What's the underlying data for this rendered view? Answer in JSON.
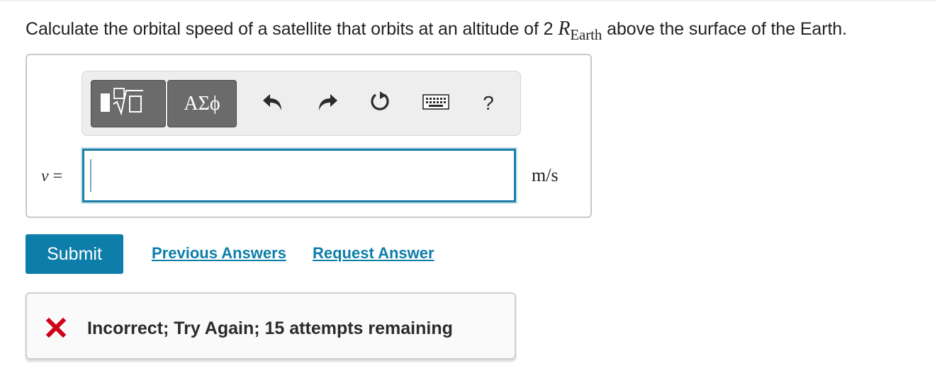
{
  "question": {
    "prefix": "Calculate the orbital speed of a satellite that orbits at an altitude of 2 ",
    "math_symbol": "R",
    "math_subscript": "Earth",
    "suffix": " above the surface of the Earth."
  },
  "toolbar": {
    "templates_icon": "templates-sqrt-icon",
    "greek_label": "ΑΣϕ",
    "undo_icon": "undo-icon",
    "redo_icon": "redo-icon",
    "reset_icon": "reset-icon",
    "keyboard_icon": "keyboard-icon",
    "help_label": "?"
  },
  "answer": {
    "variable": "v",
    "equals": " =",
    "value": "",
    "unit": "m/s"
  },
  "actions": {
    "submit_label": "Submit",
    "previous_answers_label": "Previous Answers",
    "request_answer_label": "Request Answer"
  },
  "feedback": {
    "icon": "incorrect-x-icon",
    "message": "Incorrect; Try Again; 15 attempts remaining"
  },
  "colors": {
    "accent": "#0d7ea9",
    "error": "#d0011b",
    "toolbar_button": "#6b6b6b"
  }
}
